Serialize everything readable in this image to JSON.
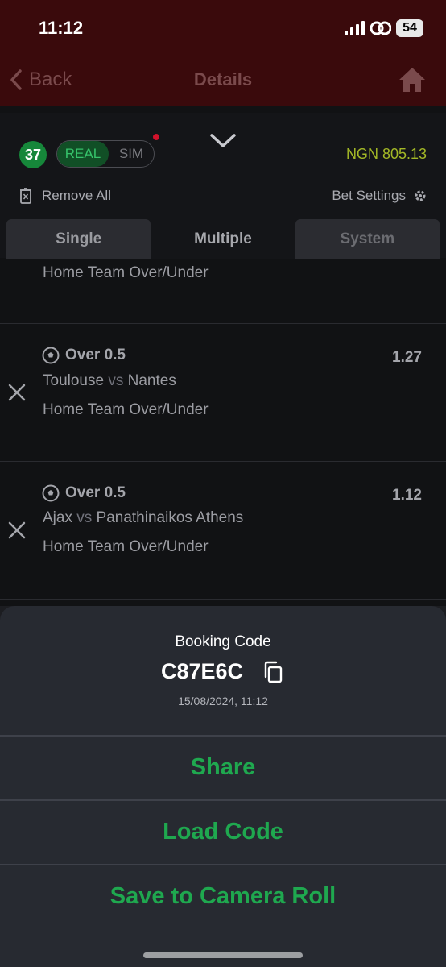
{
  "status_bar": {
    "time": "11:12",
    "battery": "54"
  },
  "nav": {
    "back_label": "Back",
    "title": "Details"
  },
  "betslip": {
    "count_badge": "37",
    "mode_real": "REAL",
    "mode_sim": "SIM",
    "balance": "NGN 805.13",
    "remove_all": "Remove All",
    "bet_settings": "Bet Settings",
    "tabs": [
      "Single",
      "Multiple",
      "System"
    ],
    "active_tab": "Multiple",
    "partial_market": "Home Team Over/Under",
    "bets": [
      {
        "selection": "Over 0.5",
        "home": "Toulouse",
        "vs": "vs",
        "away": "Nantes",
        "market": "Home Team Over/Under",
        "odds": "1.27"
      },
      {
        "selection": "Over 0.5",
        "home": "Ajax",
        "vs": "vs",
        "away": "Panathinaikos Athens",
        "market": "Home Team Over/Under",
        "odds": "1.12"
      }
    ]
  },
  "sheet": {
    "label": "Booking Code",
    "code": "C87E6C",
    "datetime": "15/08/2024, 11:12",
    "actions": [
      "Share",
      "Load Code",
      "Save to Camera Roll"
    ]
  },
  "colors": {
    "header_bg": "#3a0a0c",
    "accent_green": "#1fa84f",
    "balance_yellow": "#a3b826",
    "sheet_bg": "#272a31"
  }
}
